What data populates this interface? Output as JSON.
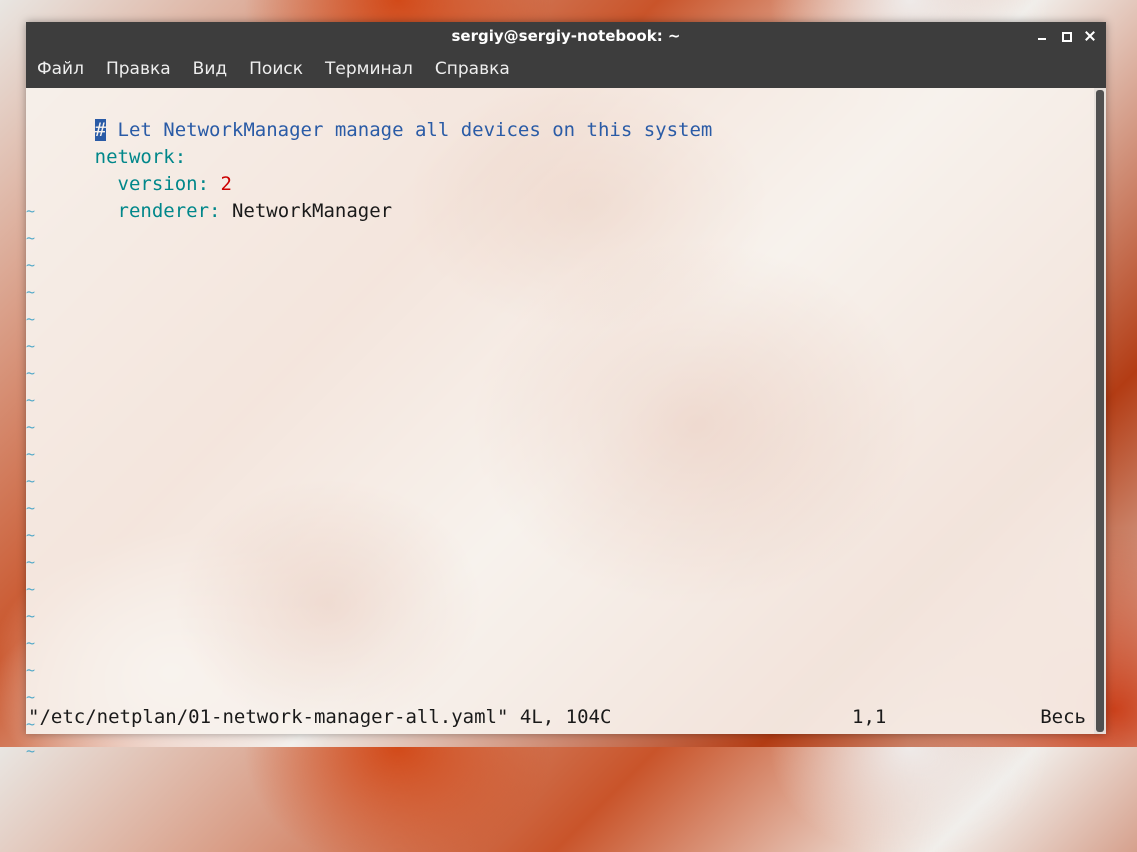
{
  "window": {
    "title": "sergiy@sergiy-notebook: ~",
    "controls": [
      "minimize-icon",
      "maximize-icon",
      "close-icon"
    ]
  },
  "menu": [
    "Файл",
    "Правка",
    "Вид",
    "Поиск",
    "Терминал",
    "Справка"
  ],
  "editor": {
    "comment_hash": "#",
    "comment_text": " Let NetworkManager manage all devices on this system",
    "line2_key": "network",
    "line2_colon": ":",
    "line3_indent": "  ",
    "line3_key": "version",
    "line3_colon": ": ",
    "line3_value": "2",
    "line4_indent": "  ",
    "line4_key": "renderer",
    "line4_colon": ": ",
    "line4_value": "NetworkManager",
    "empty_line_marker": "~"
  },
  "status": {
    "file": "\"/etc/netplan/01-network-manager-all.yaml\" 4L, 104C",
    "position": "1,1",
    "scroll": "Весь"
  },
  "colors": {
    "comment": "#2a5ba6",
    "key": "#00878a",
    "number": "#cc0000",
    "tilde": "#52a8c8",
    "titlebar": "#3d3d3d"
  }
}
